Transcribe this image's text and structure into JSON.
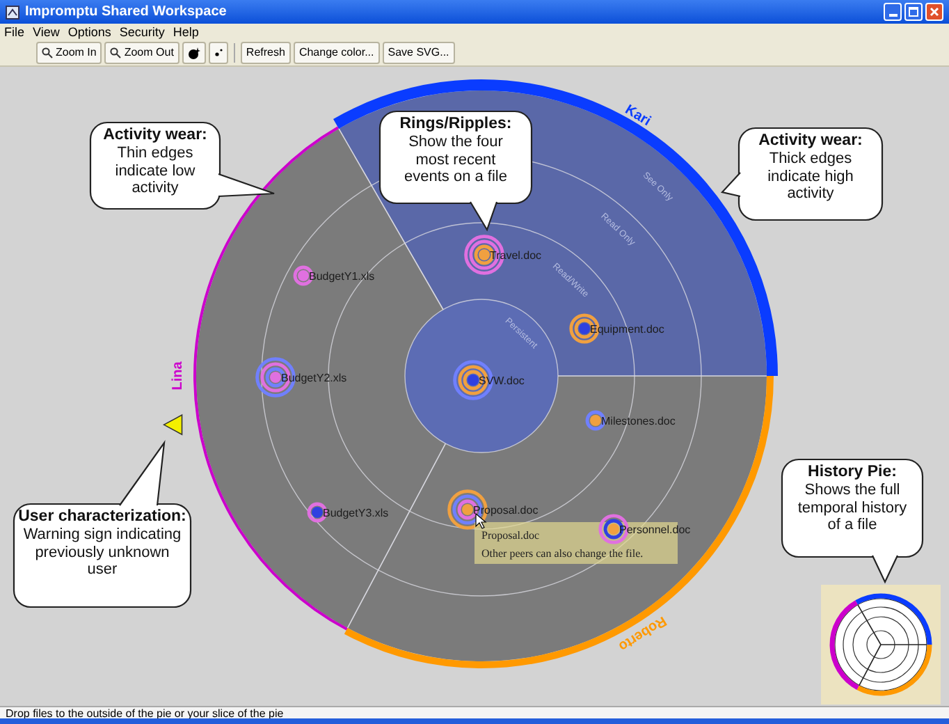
{
  "window": {
    "title": "Impromptu Shared Workspace"
  },
  "menu": [
    "File",
    "View",
    "Options",
    "Security",
    "Help"
  ],
  "toolbar": [
    {
      "kind": "zoom",
      "label": "Zoom In"
    },
    {
      "kind": "zoom",
      "label": "Zoom Out"
    },
    {
      "kind": "dot-large"
    },
    {
      "kind": "dot-small"
    },
    {
      "kind": "separator"
    },
    {
      "kind": "text",
      "label": "Refresh"
    },
    {
      "kind": "text",
      "label": "Change color..."
    },
    {
      "kind": "text",
      "label": "Save SVG..."
    }
  ],
  "pie": {
    "slices": [
      {
        "user": "Kari",
        "color": "#0a3cff",
        "selected": true,
        "warning": false
      },
      {
        "user": "Roberto",
        "color": "#ff9900",
        "selected": false,
        "warning": false
      },
      {
        "user": "Lina",
        "color": "#cc00cc",
        "selected": false,
        "warning": true
      }
    ],
    "rings": [
      "Persistent",
      "Read/Write",
      "Read Only",
      "See Only"
    ]
  },
  "files": [
    {
      "name": "Travel.doc"
    },
    {
      "name": "Equipment.doc"
    },
    {
      "name": "SVW.doc"
    },
    {
      "name": "BudgetY1.xls"
    },
    {
      "name": "BudgetY2.xls"
    },
    {
      "name": "Milestones.doc"
    },
    {
      "name": "BudgetY3.xls"
    },
    {
      "name": "Proposal.doc"
    },
    {
      "name": "Personnel.doc"
    }
  ],
  "tooltip": {
    "title": "Proposal.doc",
    "text": "Other peers can also change the file."
  },
  "callouts": [
    {
      "title": "Activity wear:",
      "text": "Thin edges indicate low activity"
    },
    {
      "title": "Rings/Ripples:",
      "text": "Show the four most recent events on a file"
    },
    {
      "title": "Activity wear:",
      "text": "Thick edges indicate high activity"
    },
    {
      "title": "User characterization:",
      "text": "Warning sign indicating previously unknown user"
    },
    {
      "title": "History Pie:",
      "text": "Shows the full temporal history of a file"
    }
  ],
  "status_bar": "Drop files to the outside of the pie or your slice of the pie"
}
